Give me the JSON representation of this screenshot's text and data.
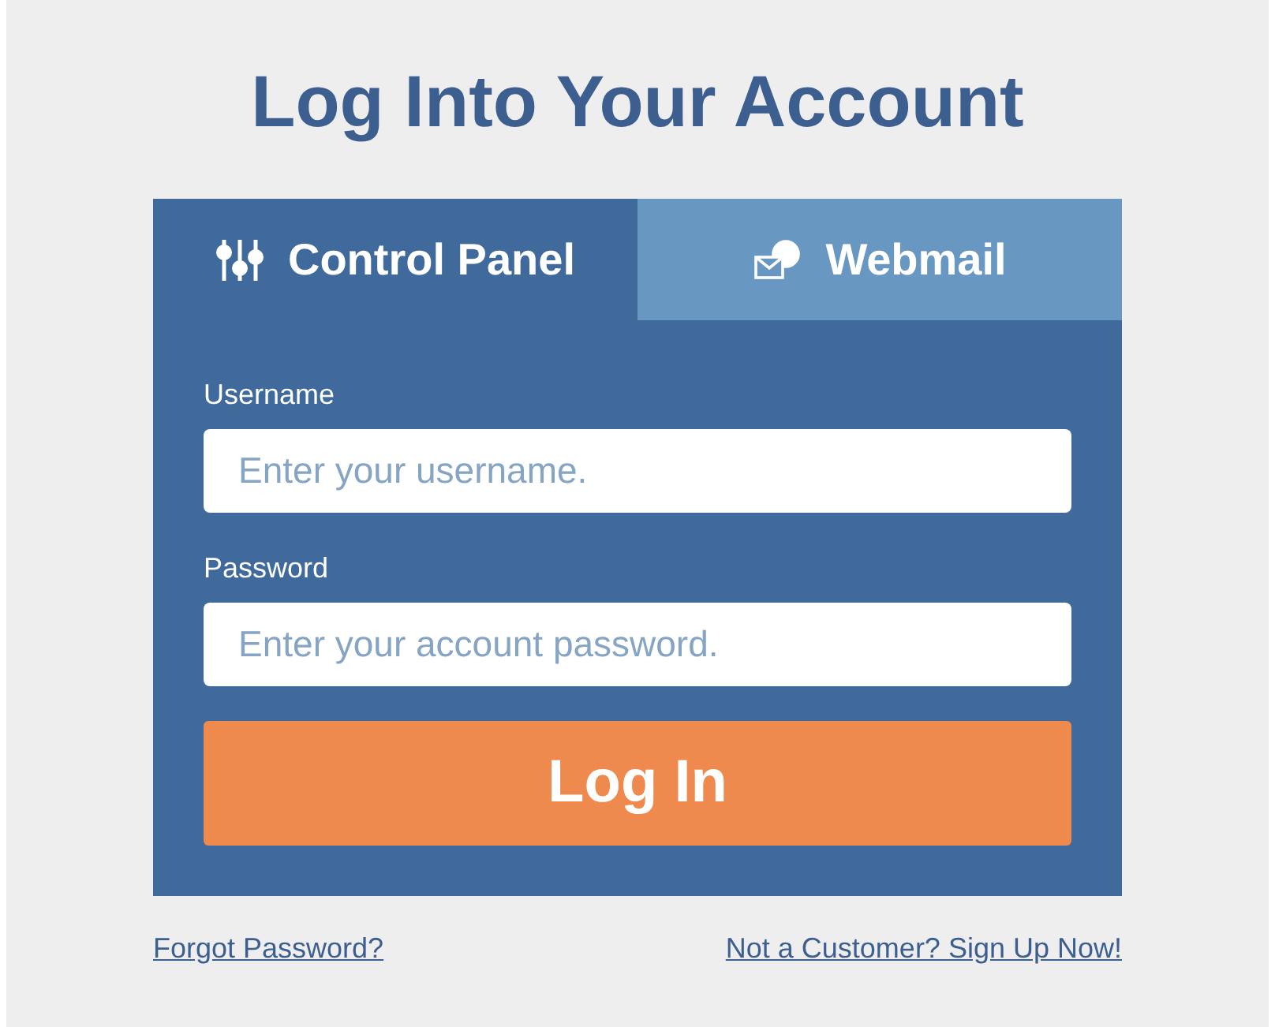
{
  "title": "Log Into Your Account",
  "tabs": [
    {
      "label": "Control Panel",
      "kind": "sliders",
      "selected": true
    },
    {
      "label": "Webmail",
      "kind": "mail",
      "selected": false
    }
  ],
  "fields": [
    {
      "label": "Username",
      "placeholder": "Enter your username."
    },
    {
      "label": "Password",
      "placeholder": "Enter your account password."
    }
  ],
  "submit": "Log In",
  "links": [
    "Forgot Password?",
    "Not a Customer? Sign Up Now!"
  ]
}
